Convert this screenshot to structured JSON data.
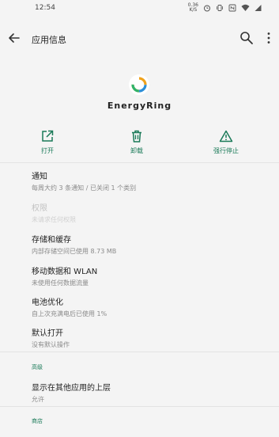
{
  "status_bar": {
    "time": "12:54",
    "net_speed_value": "0.36",
    "net_speed_unit": "K/S",
    "icons": [
      "alarm-icon",
      "vibrate-icon",
      "nfc-icon",
      "wifi-icon",
      "signal-icon"
    ]
  },
  "app_bar": {
    "title": "应用信息"
  },
  "app": {
    "name": "EnergyRing"
  },
  "actions": {
    "open": "打开",
    "uninstall": "卸载",
    "force_stop": "强行停止"
  },
  "settings": [
    {
      "title": "通知",
      "subtitle": "每周大约 3 条通知 / 已关闭 1 个类别"
    },
    {
      "title": "权限",
      "subtitle": "未请求任何权限"
    },
    {
      "title": "存储和缓存",
      "subtitle": "内部存储空间已使用 8.73 MB"
    },
    {
      "title": "移动数据和 WLAN",
      "subtitle": "未使用任何数据流量"
    },
    {
      "title": "电池优化",
      "subtitle": "自上次充满电后已使用 1%"
    },
    {
      "title": "默认打开",
      "subtitle": "没有默认操作"
    }
  ],
  "advanced": {
    "header": "高级",
    "items": [
      {
        "title": "显示在其他应用的上层",
        "subtitle": "允许"
      }
    ]
  },
  "store": {
    "header": "商店"
  },
  "colors": {
    "accent": "#1a7a58",
    "background": "#f4f4f4"
  }
}
